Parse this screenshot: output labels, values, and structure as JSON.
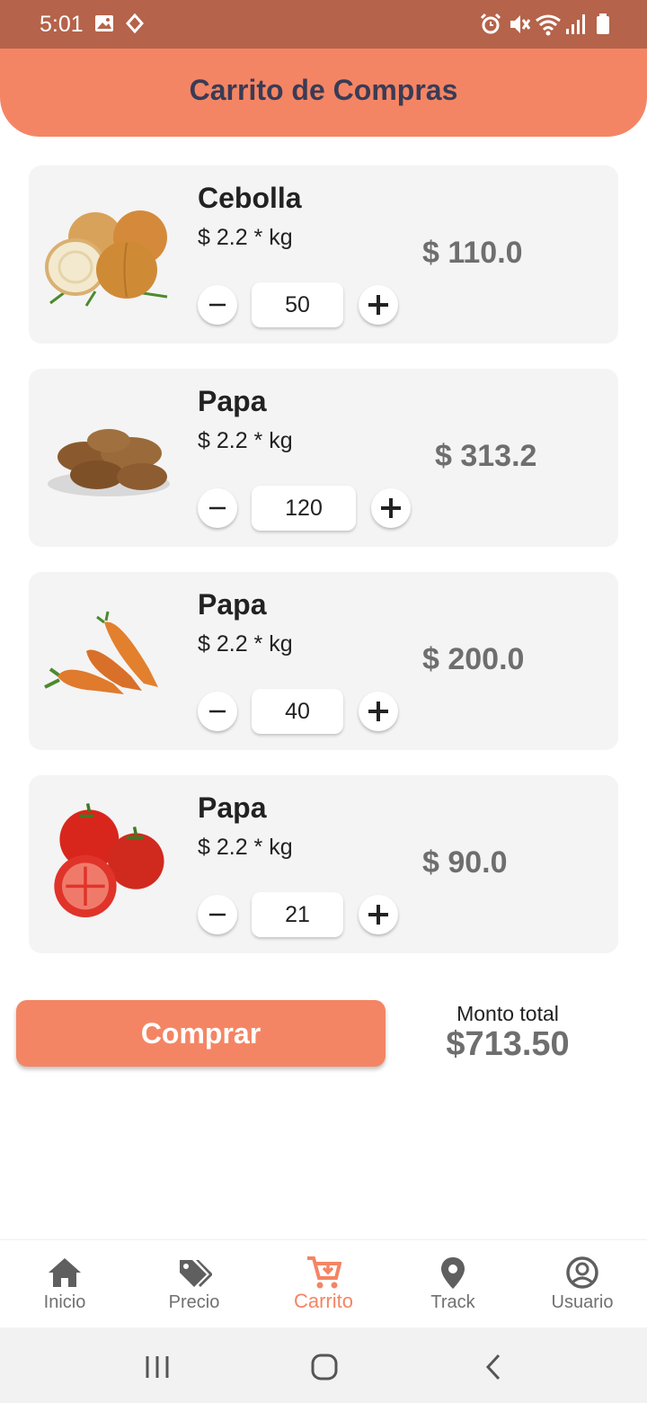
{
  "status_bar": {
    "time": "5:01"
  },
  "header": {
    "title": "Carrito de Compras"
  },
  "cart_items": [
    {
      "name": "Cebolla",
      "unit_price": "$ 2.2 * kg",
      "quantity": "50",
      "subtotal": "$ 110.0",
      "image": "onion-image"
    },
    {
      "name": "Papa",
      "unit_price": "$ 2.2 * kg",
      "quantity": "120",
      "subtotal": "$ 313.2",
      "image": "potato-image"
    },
    {
      "name": "Papa",
      "unit_price": "$ 2.2 * kg",
      "quantity": "40",
      "subtotal": "$ 200.0",
      "image": "carrot-image"
    },
    {
      "name": "Papa",
      "unit_price": "$ 2.2 * kg",
      "quantity": "21",
      "subtotal": "$ 90.0",
      "image": "tomato-image"
    }
  ],
  "checkout": {
    "buy_label": "Comprar",
    "total_label": "Monto total",
    "total_amount": "$713.50"
  },
  "bottom_nav": {
    "items": [
      {
        "label": "Inicio",
        "icon": "home-icon"
      },
      {
        "label": "Precio",
        "icon": "price-tag-icon"
      },
      {
        "label": "Carrito",
        "icon": "cart-icon",
        "active": true
      },
      {
        "label": "Track",
        "icon": "location-pin-icon"
      },
      {
        "label": "Usuario",
        "icon": "user-icon"
      }
    ]
  },
  "colors": {
    "accent": "#f48564",
    "status_bar": "#b5634a",
    "title_text": "#3a3b55",
    "card_bg": "#f4f4f4"
  }
}
